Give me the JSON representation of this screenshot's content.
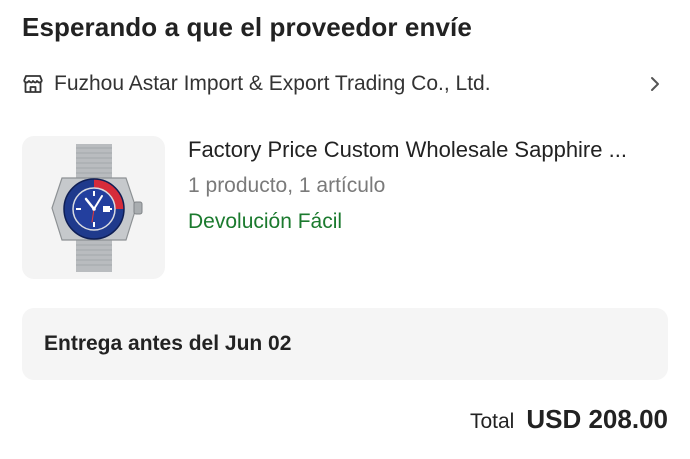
{
  "order": {
    "status_title": "Esperando a que el proveedor envíe",
    "supplier": {
      "icon": "store-icon",
      "name": "Fuzhou Astar Import & Export Trading Co., Ltd."
    },
    "product": {
      "image_icon": "watch-image",
      "title": "Factory Price Custom Wholesale Sapphire ...",
      "quantity_text": "1 producto, 1 artículo",
      "return_policy": "Devolución Fácil"
    },
    "delivery_text": "Entrega antes del Jun 02",
    "total": {
      "label": "Total",
      "value": "USD 208.00"
    }
  },
  "colors": {
    "return_policy_green": "#1b7a2e",
    "delivery_box_bg": "#f5f5f5",
    "thumb_bg": "#f4f4f4"
  }
}
